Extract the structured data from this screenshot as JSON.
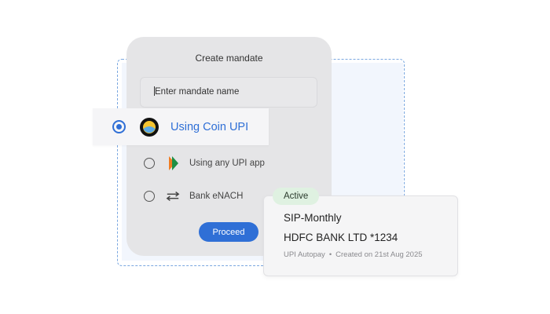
{
  "mandate_form": {
    "title": "Create mandate",
    "name_input_placeholder": "Enter mandate name",
    "options": [
      {
        "label": "Using Coin UPI",
        "selected": true
      },
      {
        "label": "Using any UPI app",
        "selected": false
      },
      {
        "label": "Bank eNACH",
        "selected": false
      }
    ],
    "proceed_label": "Proceed"
  },
  "mandate_card": {
    "status": "Active",
    "plan": "SIP-Monthly",
    "bank": "HDFC BANK LTD *1234",
    "method": "UPI Autopay",
    "separator": "•",
    "created": "Created on 21st Aug 2025"
  },
  "colors": {
    "accent": "#2f6fd6",
    "active_badge_bg": "#dff1e1",
    "frame_dashed": "#7aa7e0"
  },
  "icons": {
    "coin": "coin-logo-icon",
    "upi": "upi-logo-icon",
    "enach": "transfer-arrows-icon"
  }
}
